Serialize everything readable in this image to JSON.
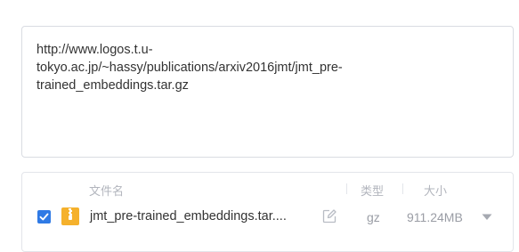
{
  "url_box": {
    "line1": "http://www.logos.t.u-",
    "line2": "tokyo.ac.jp/~hassy/publications/arxiv2016jmt/jmt_pre-",
    "line3": "trained_embeddings.tar.gz"
  },
  "file_list": {
    "headers": {
      "name": "文件名",
      "type": "类型",
      "size": "大小"
    },
    "rows": [
      {
        "checked": true,
        "icon": "zip-file-icon",
        "name": "jmt_pre-trained_embeddings.tar....",
        "type": "gz",
        "size": "911.24MB"
      }
    ]
  },
  "colors": {
    "accent": "#2f7ae5",
    "archive_icon": "#f5b12c"
  }
}
